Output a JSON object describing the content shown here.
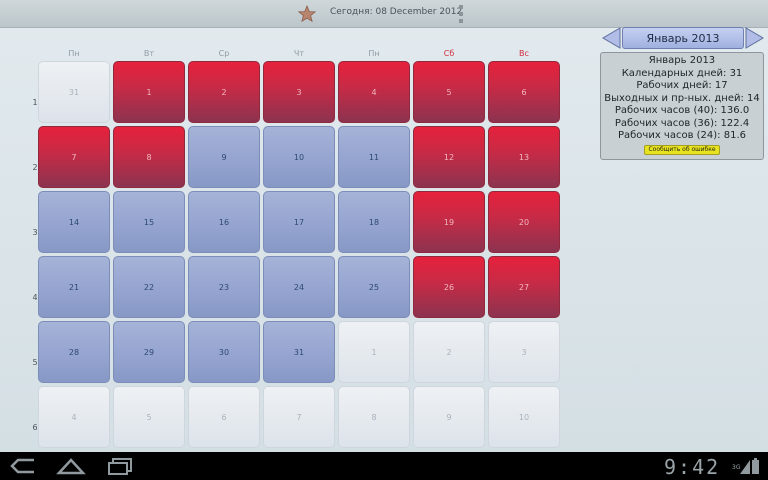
{
  "topbar": {
    "today_label": "Сегодня: 08 December 2012",
    "star_icon": "star-icon",
    "menu_icon": "overflow-menu-icon"
  },
  "weekdays": [
    {
      "label": "Пн",
      "weekend": false
    },
    {
      "label": "Вт",
      "weekend": false
    },
    {
      "label": "Ср",
      "weekend": false
    },
    {
      "label": "Чт",
      "weekend": false
    },
    {
      "label": "Пн",
      "weekend": false
    },
    {
      "label": "Сб",
      "weekend": true
    },
    {
      "label": "Вс",
      "weekend": true
    }
  ],
  "weeks": [
    {
      "number": "1",
      "days": [
        {
          "day": "31",
          "kind": "gray"
        },
        {
          "day": "1",
          "kind": "red"
        },
        {
          "day": "2",
          "kind": "red"
        },
        {
          "day": "3",
          "kind": "red"
        },
        {
          "day": "4",
          "kind": "red"
        },
        {
          "day": "5",
          "kind": "red"
        },
        {
          "day": "6",
          "kind": "red"
        }
      ]
    },
    {
      "number": "2",
      "days": [
        {
          "day": "7",
          "kind": "red"
        },
        {
          "day": "8",
          "kind": "red"
        },
        {
          "day": "9",
          "kind": "blue"
        },
        {
          "day": "10",
          "kind": "blue"
        },
        {
          "day": "11",
          "kind": "blue"
        },
        {
          "day": "12",
          "kind": "red"
        },
        {
          "day": "13",
          "kind": "red"
        }
      ]
    },
    {
      "number": "3",
      "days": [
        {
          "day": "14",
          "kind": "blue"
        },
        {
          "day": "15",
          "kind": "blue"
        },
        {
          "day": "16",
          "kind": "blue"
        },
        {
          "day": "17",
          "kind": "blue"
        },
        {
          "day": "18",
          "kind": "blue"
        },
        {
          "day": "19",
          "kind": "red"
        },
        {
          "day": "20",
          "kind": "red"
        }
      ]
    },
    {
      "number": "4",
      "days": [
        {
          "day": "21",
          "kind": "blue"
        },
        {
          "day": "22",
          "kind": "blue"
        },
        {
          "day": "23",
          "kind": "blue"
        },
        {
          "day": "24",
          "kind": "blue"
        },
        {
          "day": "25",
          "kind": "blue"
        },
        {
          "day": "26",
          "kind": "red"
        },
        {
          "day": "27",
          "kind": "red"
        }
      ]
    },
    {
      "number": "5",
      "days": [
        {
          "day": "28",
          "kind": "blue"
        },
        {
          "day": "29",
          "kind": "blue"
        },
        {
          "day": "30",
          "kind": "blue"
        },
        {
          "day": "31",
          "kind": "blue"
        },
        {
          "day": "1",
          "kind": "gray"
        },
        {
          "day": "2",
          "kind": "gray"
        },
        {
          "day": "3",
          "kind": "gray"
        }
      ]
    },
    {
      "number": "6",
      "days": [
        {
          "day": "4",
          "kind": "gray"
        },
        {
          "day": "5",
          "kind": "gray"
        },
        {
          "day": "6",
          "kind": "gray"
        },
        {
          "day": "7",
          "kind": "gray"
        },
        {
          "day": "8",
          "kind": "gray"
        },
        {
          "day": "9",
          "kind": "gray"
        },
        {
          "day": "10",
          "kind": "gray"
        }
      ]
    }
  ],
  "month_nav": {
    "month_label": "Январь 2013",
    "prev_icon": "arrow-left-icon",
    "next_icon": "arrow-right-icon"
  },
  "info": {
    "title": "Январь 2013",
    "calendar_days": "Календарных дней: 31",
    "work_days": "Рабочих дней: 17",
    "holidays": "Выходных и пр-ных. дней: 14",
    "hours_40": "Рабочих часов (40): 136.0",
    "hours_36": "Рабочих часов (36): 122.4",
    "hours_24": "Рабочих часов (24): 81.6",
    "report_button": "Сообщить об ошибке"
  },
  "systembar": {
    "clock": "9:42",
    "network": "3G",
    "back_icon": "back-icon",
    "home_icon": "home-icon",
    "recents_icon": "recent-apps-icon"
  },
  "colors": {
    "weekend": "#d02a3c",
    "holiday_cell": "#c92a45",
    "workday_cell": "#94a3cf",
    "other_month_cell": "#e6ebf0",
    "report_button": "#e8e321"
  }
}
